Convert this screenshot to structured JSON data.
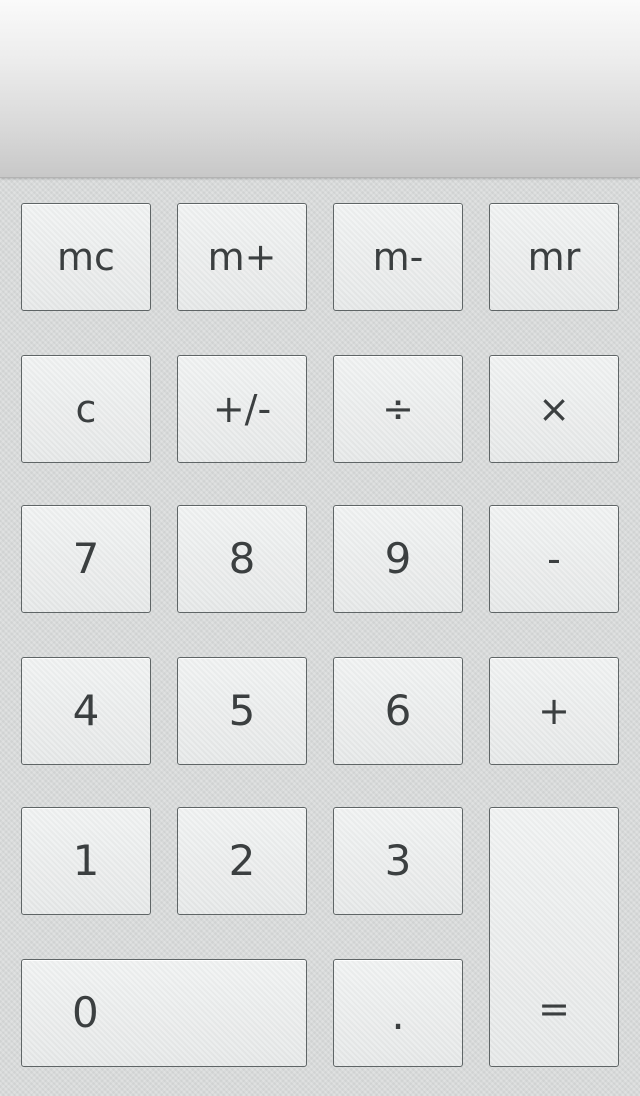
{
  "display": {
    "value": ""
  },
  "keys": {
    "mc": "mc",
    "m_plus": "m+",
    "m_minus": "m-",
    "mr": "mr",
    "clear": "c",
    "sign": "+/-",
    "divide": "÷",
    "multiply": "×",
    "seven": "7",
    "eight": "8",
    "nine": "9",
    "minus": "-",
    "four": "4",
    "five": "5",
    "six": "6",
    "plus": "+",
    "one": "1",
    "two": "2",
    "three": "3",
    "equals": "=",
    "zero": "0",
    "decimal": "."
  },
  "colors": {
    "background": "#d9dbdb",
    "key_face": "#e9ebeb",
    "key_border": "#5f6566",
    "key_text": "#3b3f40",
    "display_top": "#fafafa",
    "display_bottom": "#c8c8c8"
  }
}
